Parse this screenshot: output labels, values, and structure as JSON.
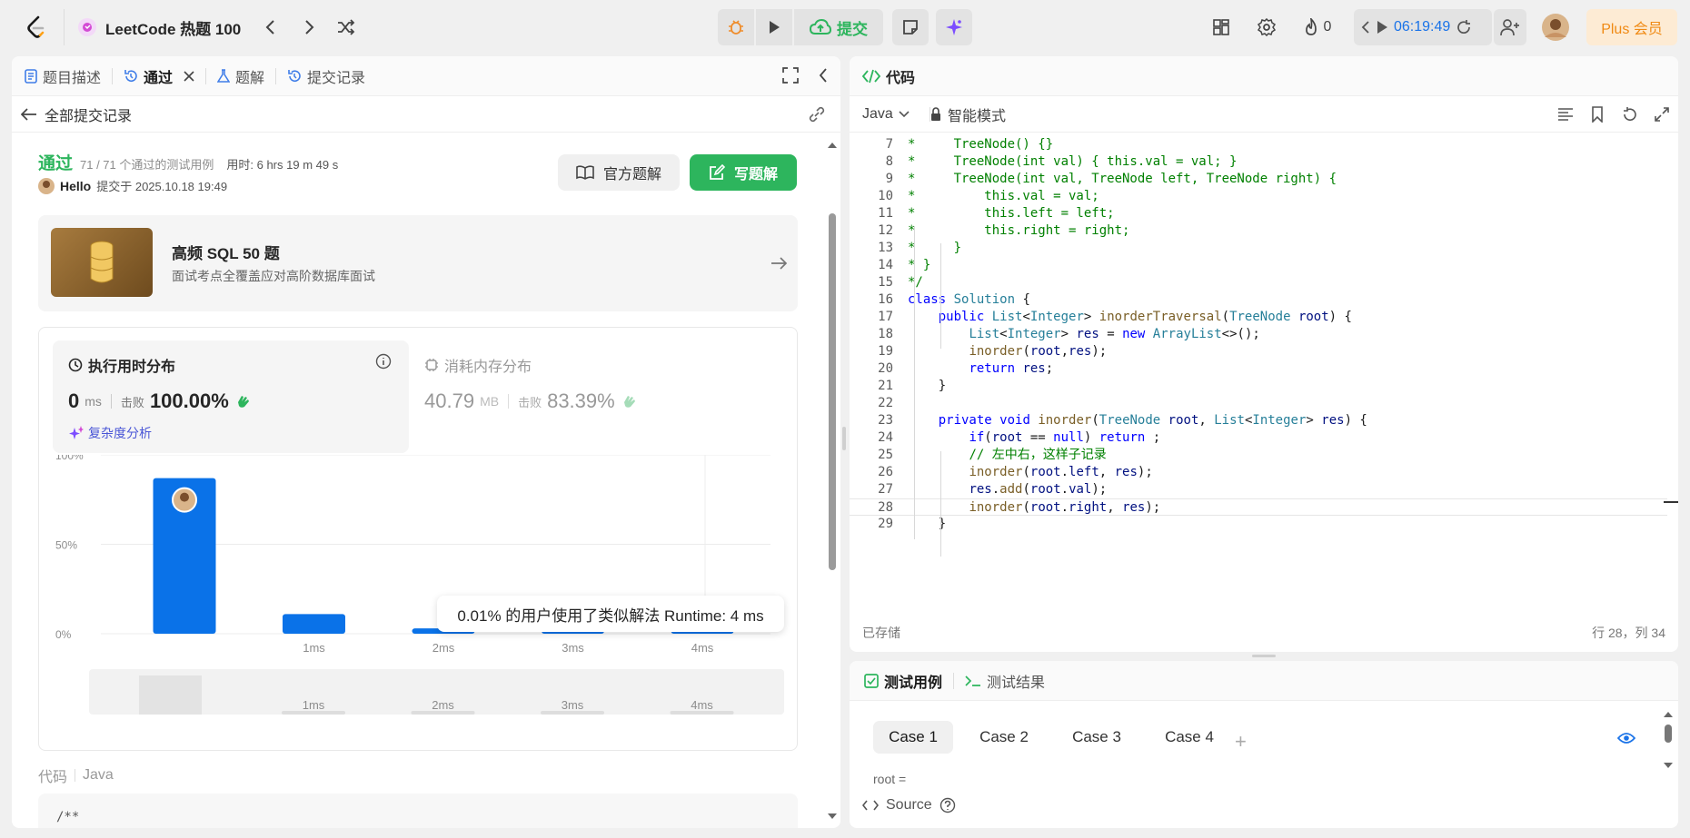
{
  "topbar": {
    "title": "LeetCode 热题 100",
    "submit_label": "提交",
    "streak": "0",
    "timer": "06:19:49",
    "plus_label": "Plus 会员"
  },
  "left": {
    "tabs": [
      {
        "label": "题目描述"
      },
      {
        "label": "通过"
      },
      {
        "label": "题解"
      },
      {
        "label": "提交记录"
      }
    ],
    "back_label": "全部提交记录",
    "status": "通过",
    "passed": "71 / 71 个通过的测试用例",
    "elapsed": "用时: 6 hrs 19 m 49 s",
    "user": "Hello",
    "submitted": "提交于 2025.10.18 19:49",
    "official_btn": "官方题解",
    "write_btn": "写题解",
    "promo_title": "高频 SQL 50 题",
    "promo_sub": "面试考点全覆盖应对高阶数据库面试",
    "runtime_title": "执行用时分布",
    "runtime_value": "0",
    "runtime_unit": "ms",
    "beats_label": "击败",
    "runtime_beats": "100.00%",
    "complexity_label": "复杂度分析",
    "memory_title": "消耗内存分布",
    "memory_value": "40.79",
    "memory_unit": "MB",
    "memory_beats": "83.39%",
    "tooltip": "0.01% 的用户使用了类似解法 Runtime: 4 ms",
    "code_label": "代码",
    "code_lang": "Java",
    "code_preview": "/**"
  },
  "chart_data": {
    "type": "bar",
    "categories": [
      "0ms",
      "1ms",
      "2ms",
      "3ms",
      "4ms"
    ],
    "x_tick_labels": [
      "",
      "1ms",
      "2ms",
      "3ms",
      "4ms"
    ],
    "values": [
      87,
      11,
      3,
      3,
      3
    ],
    "yticks": [
      "100%",
      "50%",
      "0%"
    ],
    "ylim": [
      0,
      100
    ],
    "minimap_labels": [
      "1ms",
      "2ms",
      "3ms",
      "4ms"
    ]
  },
  "editor": {
    "title": "代码",
    "lang": "Java",
    "mode": "智能模式",
    "saved": "已存储",
    "cursor": "行 28，列 34",
    "lines": [
      {
        "n": "7",
        "t": [
          [
            "cm",
            "*     TreeNode() {}"
          ]
        ]
      },
      {
        "n": "8",
        "t": [
          [
            "cm",
            "*     TreeNode(int val) { this.val = val; }"
          ]
        ]
      },
      {
        "n": "9",
        "t": [
          [
            "cm",
            "*     TreeNode(int val, TreeNode left, TreeNode right) {"
          ]
        ]
      },
      {
        "n": "10",
        "t": [
          [
            "cm",
            "*         this.val = val;"
          ]
        ]
      },
      {
        "n": "11",
        "t": [
          [
            "cm",
            "*         this.left = left;"
          ]
        ]
      },
      {
        "n": "12",
        "t": [
          [
            "cm",
            "*         this.right = right;"
          ]
        ]
      },
      {
        "n": "13",
        "t": [
          [
            "cm",
            "*     }"
          ]
        ]
      },
      {
        "n": "14",
        "t": [
          [
            "cm",
            "* }"
          ]
        ]
      },
      {
        "n": "15",
        "t": [
          [
            "cm",
            "*/"
          ]
        ]
      },
      {
        "n": "16",
        "t": [
          [
            "kw",
            "class"
          ],
          [
            "pl",
            " "
          ],
          [
            "ty",
            "Solution"
          ],
          [
            "pl",
            " {"
          ]
        ]
      },
      {
        "n": "17",
        "t": [
          [
            "pl",
            "    "
          ],
          [
            "kw",
            "public"
          ],
          [
            "pl",
            " "
          ],
          [
            "ty",
            "List"
          ],
          [
            "pl",
            "<"
          ],
          [
            "ty",
            "Integer"
          ],
          [
            "pl",
            "> "
          ],
          [
            "fn",
            "inorderTraversal"
          ],
          [
            "pl",
            "("
          ],
          [
            "ty",
            "TreeNode"
          ],
          [
            "pl",
            " "
          ],
          [
            "va",
            "root"
          ],
          [
            "pl",
            ") {"
          ]
        ]
      },
      {
        "n": "18",
        "t": [
          [
            "pl",
            "        "
          ],
          [
            "ty",
            "List"
          ],
          [
            "pl",
            "<"
          ],
          [
            "ty",
            "Integer"
          ],
          [
            "pl",
            "> "
          ],
          [
            "va",
            "res"
          ],
          [
            "pl",
            " = "
          ],
          [
            "kw",
            "new"
          ],
          [
            "pl",
            " "
          ],
          [
            "ty",
            "ArrayList"
          ],
          [
            "pl",
            "<>();"
          ]
        ]
      },
      {
        "n": "19",
        "t": [
          [
            "pl",
            "        "
          ],
          [
            "fn",
            "inorder"
          ],
          [
            "pl",
            "("
          ],
          [
            "va",
            "root"
          ],
          [
            "pl",
            ","
          ],
          [
            "va",
            "res"
          ],
          [
            "pl",
            ");"
          ]
        ]
      },
      {
        "n": "20",
        "t": [
          [
            "pl",
            "        "
          ],
          [
            "kw",
            "return"
          ],
          [
            "pl",
            " "
          ],
          [
            "va",
            "res"
          ],
          [
            "pl",
            ";"
          ]
        ]
      },
      {
        "n": "21",
        "t": [
          [
            "pl",
            "    }"
          ]
        ]
      },
      {
        "n": "22",
        "t": [
          [
            "pl",
            ""
          ]
        ]
      },
      {
        "n": "23",
        "t": [
          [
            "pl",
            "    "
          ],
          [
            "kw",
            "private"
          ],
          [
            "pl",
            " "
          ],
          [
            "kw",
            "void"
          ],
          [
            "pl",
            " "
          ],
          [
            "fn",
            "inorder"
          ],
          [
            "pl",
            "("
          ],
          [
            "ty",
            "TreeNode"
          ],
          [
            "pl",
            " "
          ],
          [
            "va",
            "root"
          ],
          [
            "pl",
            ", "
          ],
          [
            "ty",
            "List"
          ],
          [
            "pl",
            "<"
          ],
          [
            "ty",
            "Integer"
          ],
          [
            "pl",
            "> "
          ],
          [
            "va",
            "res"
          ],
          [
            "pl",
            ") {"
          ]
        ]
      },
      {
        "n": "24",
        "t": [
          [
            "pl",
            "        "
          ],
          [
            "kw",
            "if"
          ],
          [
            "pl",
            "("
          ],
          [
            "va",
            "root"
          ],
          [
            "pl",
            " == "
          ],
          [
            "kw",
            "null"
          ],
          [
            "pl",
            ") "
          ],
          [
            "kw",
            "return"
          ],
          [
            "pl",
            " ;"
          ]
        ]
      },
      {
        "n": "25",
        "t": [
          [
            "pl",
            "        "
          ],
          [
            "cm",
            "// 左中右，这样子记录"
          ]
        ]
      },
      {
        "n": "26",
        "t": [
          [
            "pl",
            "        "
          ],
          [
            "fn",
            "inorder"
          ],
          [
            "pl",
            "("
          ],
          [
            "va",
            "root"
          ],
          [
            "pl",
            "."
          ],
          [
            "va",
            "left"
          ],
          [
            "pl",
            ", "
          ],
          [
            "va",
            "res"
          ],
          [
            "pl",
            ");"
          ]
        ]
      },
      {
        "n": "27",
        "t": [
          [
            "pl",
            "        "
          ],
          [
            "va",
            "res"
          ],
          [
            "pl",
            "."
          ],
          [
            "fn",
            "add"
          ],
          [
            "pl",
            "("
          ],
          [
            "va",
            "root"
          ],
          [
            "pl",
            "."
          ],
          [
            "va",
            "val"
          ],
          [
            "pl",
            ");"
          ]
        ]
      },
      {
        "n": "28",
        "t": [
          [
            "pl",
            "        "
          ],
          [
            "fn",
            "inorder"
          ],
          [
            "pl",
            "("
          ],
          [
            "va",
            "root"
          ],
          [
            "pl",
            "."
          ],
          [
            "va",
            "right"
          ],
          [
            "pl",
            ", "
          ],
          [
            "va",
            "res"
          ],
          [
            "pl",
            ");"
          ]
        ]
      },
      {
        "n": "29",
        "t": [
          [
            "pl",
            "    }"
          ]
        ]
      }
    ]
  },
  "tests": {
    "tab_cases": "测试用例",
    "tab_result": "测试结果",
    "cases": [
      "Case 1",
      "Case 2",
      "Case 3",
      "Case 4"
    ],
    "param": "root =",
    "source": "Source"
  }
}
